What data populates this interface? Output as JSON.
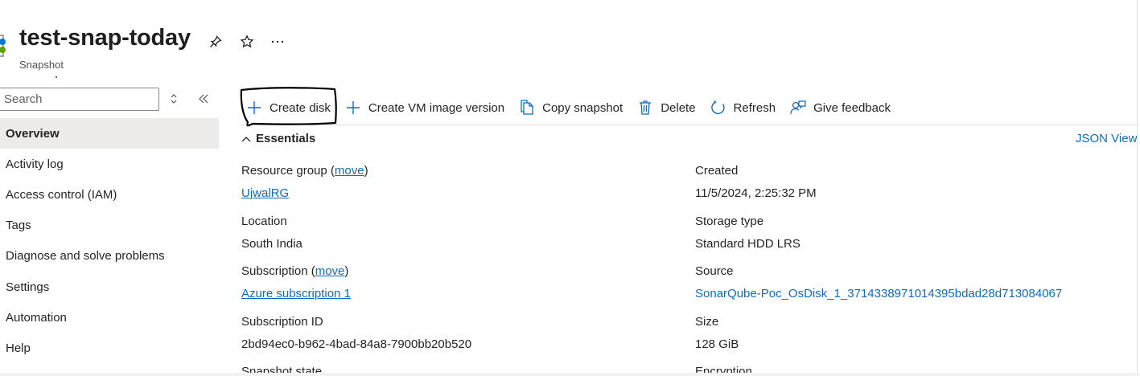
{
  "header": {
    "title": "test-snap-today",
    "subtitle": "Snapshot",
    "icons": [
      "pin-icon",
      "star-icon",
      "more-icon"
    ]
  },
  "sidebar": {
    "search_placeholder": "Search",
    "items": [
      {
        "label": "Overview",
        "active": true
      },
      {
        "label": "Activity log"
      },
      {
        "label": "Access control (IAM)"
      },
      {
        "label": "Tags"
      },
      {
        "label": "Diagnose and solve problems"
      },
      {
        "label": "Settings"
      },
      {
        "label": "Automation"
      },
      {
        "label": "Help"
      }
    ]
  },
  "toolbar": {
    "create_disk": "Create disk",
    "create_vm_image": "Create VM image version",
    "copy_snapshot": "Copy snapshot",
    "delete": "Delete",
    "refresh": "Refresh",
    "give_feedback": "Give feedback"
  },
  "essentials": {
    "heading": "Essentials",
    "json_view": "JSON View",
    "left": {
      "resource_group_label": "Resource group",
      "move_label": "move",
      "resource_group_value": "UjwalRG",
      "location_label": "Location",
      "location_value": "South India",
      "subscription_label": "Subscription",
      "subscription_value": "Azure subscription 1",
      "subscription_id_label": "Subscription ID",
      "subscription_id_value": "2bd94ec0-b962-4bad-84a8-7900bb20b520",
      "snapshot_state_label": "Snapshot state"
    },
    "right": {
      "created_label": "Created",
      "created_value": "11/5/2024, 2:25:32 PM",
      "storage_type_label": "Storage type",
      "storage_type_value": "Standard HDD LRS",
      "source_label": "Source",
      "source_value": "SonarQube-Poc_OsDisk_1_3714338971014395bdad28d713084067",
      "size_label": "Size",
      "size_value": "128 GiB",
      "encryption_label": "Encryption"
    }
  },
  "colors": {
    "link": "#0f6cbd",
    "active_nav": "#edebe9",
    "text": "#242424"
  }
}
